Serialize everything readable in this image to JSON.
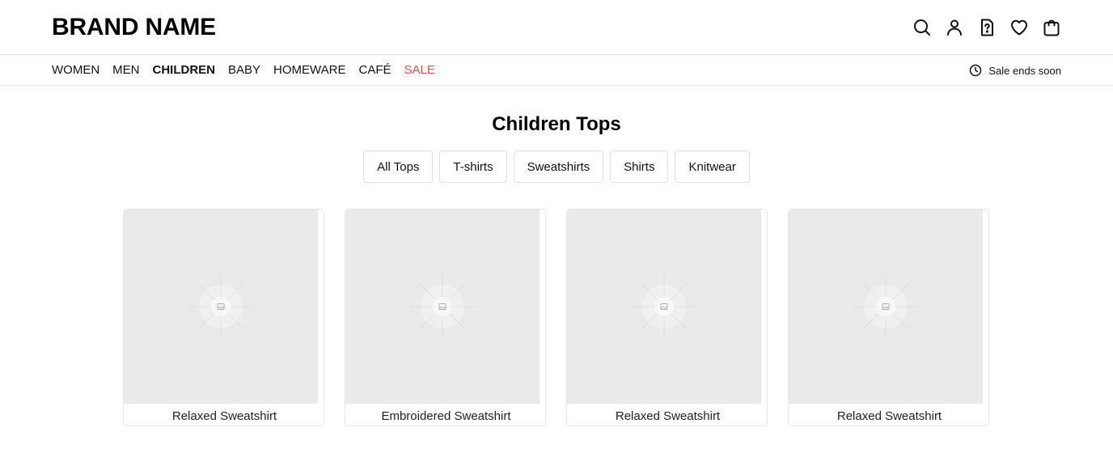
{
  "header": {
    "brand": "BRAND NAME",
    "icons": [
      "search-icon",
      "account-icon",
      "help-icon",
      "wishlist-heart-icon",
      "shopping-bag-icon"
    ]
  },
  "nav": {
    "items": [
      {
        "label": "WOMEN"
      },
      {
        "label": "MEN"
      },
      {
        "label": "CHILDREN"
      },
      {
        "label": "BABY"
      },
      {
        "label": "HOMEWARE"
      },
      {
        "label": "CAFÉ"
      },
      {
        "label": "SALE"
      }
    ],
    "active": "CHILDREN",
    "sale_color": "#e74c4c",
    "sale_note": "Sale ends soon"
  },
  "main": {
    "title": "Children Tops",
    "filters": [
      "All Tops",
      "T-shirts",
      "Sweatshirts",
      "Shirts",
      "Knitwear"
    ],
    "products": [
      {
        "name": "Relaxed Sweatshirt"
      },
      {
        "name": "Embroidered Sweatshirt"
      },
      {
        "name": "Relaxed Sweatshirt"
      },
      {
        "name": "Relaxed Sweatshirt"
      }
    ]
  }
}
